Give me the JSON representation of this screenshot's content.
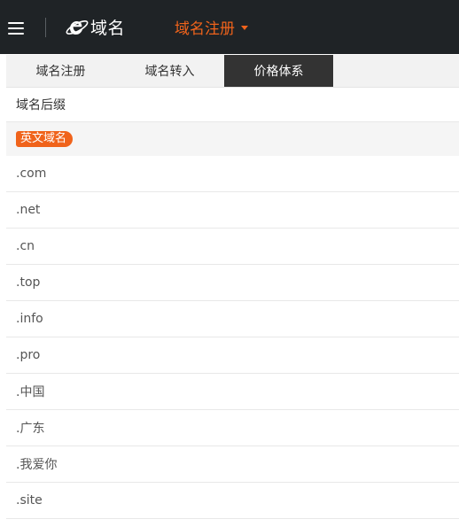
{
  "header": {
    "logo_text": "域名",
    "dropdown_label": "域名注册"
  },
  "tabs": [
    {
      "label": "域名注册"
    },
    {
      "label": "域名转入"
    },
    {
      "label": "价格体系"
    }
  ],
  "table": {
    "column_header": "域名后缀",
    "category": "英文域名",
    "suffixes": [
      ".com",
      ".net",
      ".cn",
      ".top",
      ".info",
      ".pro",
      ".中国",
      ".广东",
      ".我爱你",
      ".site"
    ]
  },
  "colors": {
    "accent": "#f0631b",
    "topbar": "#1f2326",
    "active_tab": "#333333"
  }
}
